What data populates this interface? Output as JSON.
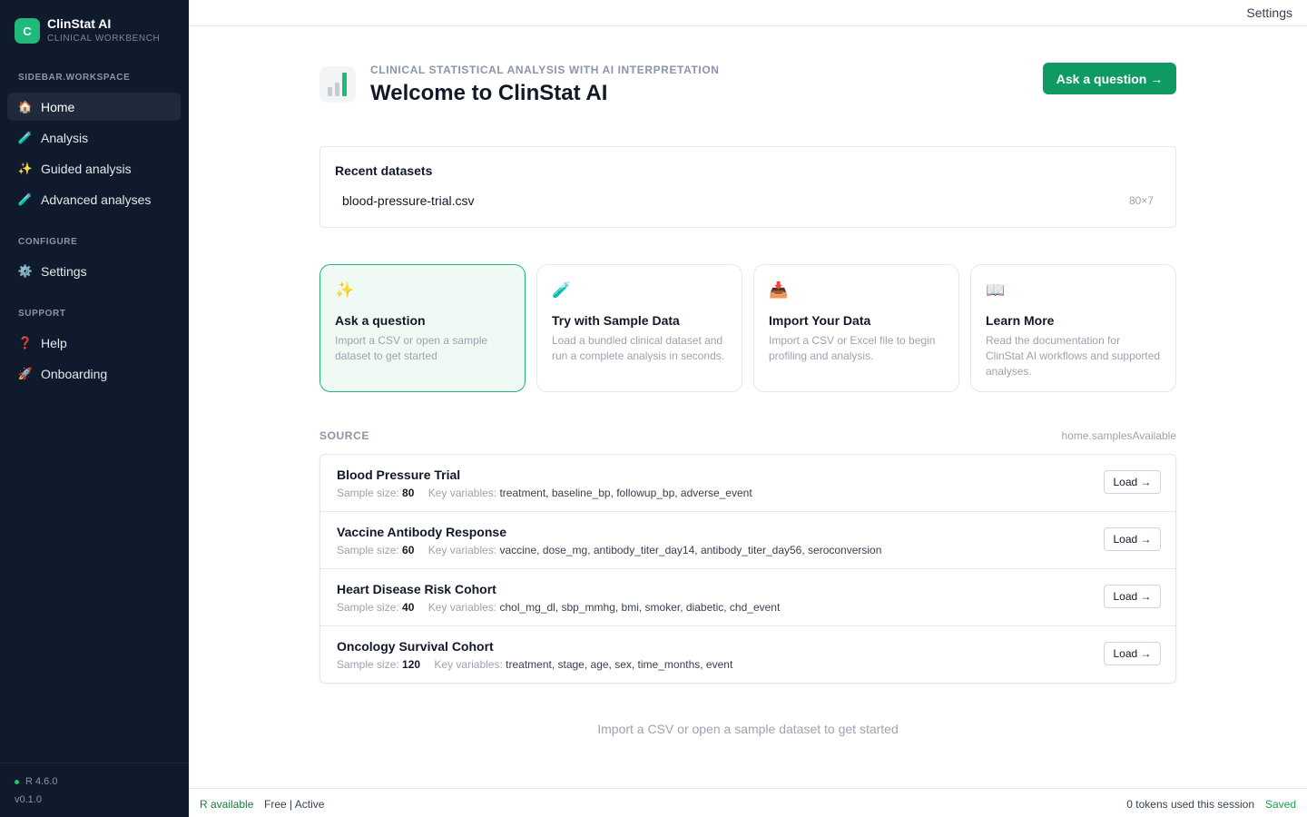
{
  "brand": {
    "logo_letter": "C",
    "title": "ClinStat AI",
    "subtitle": "CLINICAL WORKBENCH"
  },
  "sidebar": {
    "sections": [
      {
        "label": "SIDEBAR.WORKSPACE"
      },
      {
        "label": "CONFIGURE"
      },
      {
        "label": "SUPPORT"
      }
    ],
    "items": [
      {
        "label": "Home",
        "icon": "🏠",
        "active": true
      },
      {
        "label": "Analysis",
        "icon": "🧪"
      },
      {
        "label": "Guided analysis",
        "icon": "✨"
      },
      {
        "label": "Advanced analyses",
        "icon": "🧪"
      },
      {
        "label": "Settings",
        "icon": "⚙️"
      },
      {
        "label": "Help",
        "icon": "❓"
      },
      {
        "label": "Onboarding",
        "icon": "🚀"
      }
    ],
    "footer": {
      "r_version": "R 4.6.0",
      "app_version": "v0.1.0"
    }
  },
  "topbar": {
    "settings_label": "Settings"
  },
  "header": {
    "eyebrow": "CLINICAL STATISTICAL ANALYSIS WITH AI INTERPRETATION",
    "title": "Welcome to ClinStat AI",
    "ask_button": "Ask a question →"
  },
  "recent": {
    "title": "Recent datasets",
    "items": [
      {
        "name": "blood-pressure-trial.csv",
        "dims": "80×7"
      }
    ]
  },
  "cards": [
    {
      "icon": "✨",
      "title": "Ask a question",
      "desc": "Import a CSV or open a sample dataset to get started"
    },
    {
      "icon": "🧪",
      "title": "Try with Sample Data",
      "desc": "Load a bundled clinical dataset and run a complete analysis in seconds."
    },
    {
      "icon": "📥",
      "title": "Import Your Data",
      "desc": "Import a CSV or Excel file to begin profiling and analysis."
    },
    {
      "icon": "📖",
      "title": "Learn More",
      "desc": "Read the documentation for ClinStat AI workflows and supported analyses."
    }
  ],
  "source": {
    "label": "SOURCE",
    "right_label": "home.samplesAvailable"
  },
  "samples": {
    "sample_size_label": "Sample size:",
    "key_variables_label": "Key variables:",
    "load_label": "Load →",
    "items": [
      {
        "name": "Blood Pressure Trial",
        "n": "80",
        "vars": "treatment, baseline_bp, followup_bp, adverse_event"
      },
      {
        "name": "Vaccine Antibody Response",
        "n": "60",
        "vars": "vaccine, dose_mg, antibody_titer_day14, antibody_titer_day56, seroconversion"
      },
      {
        "name": "Heart Disease Risk Cohort",
        "n": "40",
        "vars": "chol_mg_dl, sbp_mmhg, bmi, smoker, diabetic, chd_event"
      },
      {
        "name": "Oncology Survival Cohort",
        "n": "120",
        "vars": "treatment, stage, age, sex, time_months, event"
      }
    ]
  },
  "empty_hint": "Import a CSV or open a sample dataset to get started",
  "statusbar": {
    "r_status": "R available",
    "plan": "Free | Active",
    "tokens": "0 tokens used this session",
    "saved": "Saved"
  },
  "colors": {
    "accent": "#0f9a63",
    "sidebar_bg": "#0f1b2d",
    "card_highlight": "#22b377"
  }
}
